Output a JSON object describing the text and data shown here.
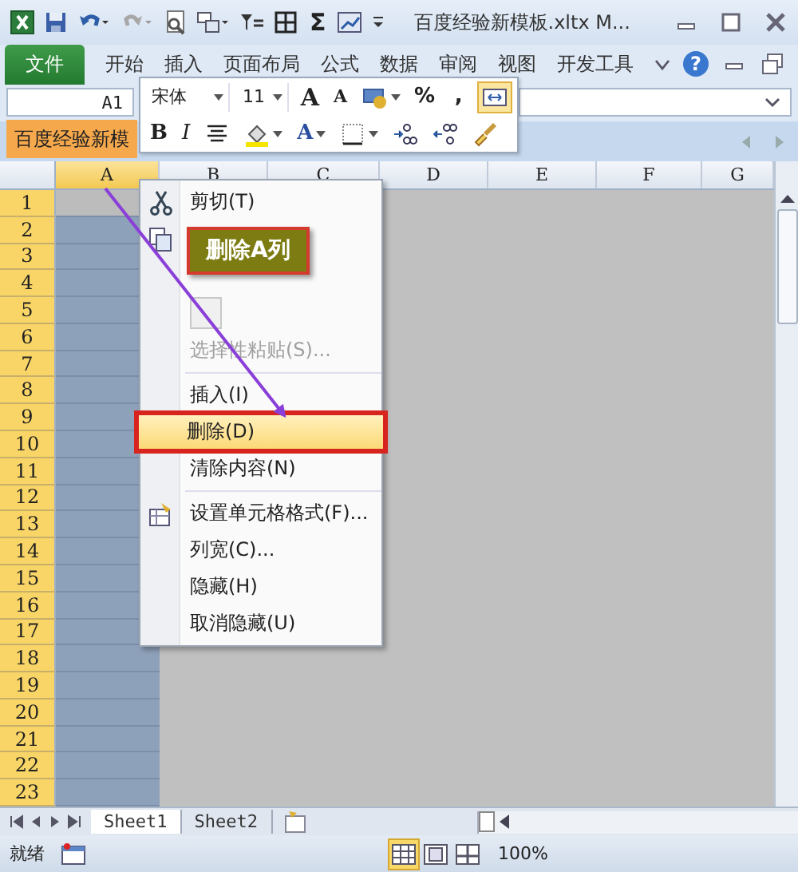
{
  "title_bar": {
    "title": "百度经验新模板.xltx M...",
    "quick_access": [
      {
        "kind": "logo"
      },
      {
        "kind": "save"
      },
      {
        "kind": "undo"
      },
      {
        "kind": "redo"
      },
      {
        "kind": "preview"
      },
      {
        "kind": "layout"
      },
      {
        "kind": "filter"
      },
      {
        "kind": "borders"
      },
      {
        "kind": "sum",
        "label": "Σ"
      },
      {
        "kind": "chart"
      },
      {
        "kind": "customize"
      }
    ]
  },
  "ribbon_tabs": [
    {
      "label": "文件",
      "kind": "file"
    },
    {
      "label": "开始",
      "kind": "tab"
    },
    {
      "label": "插入",
      "kind": "tab"
    },
    {
      "label": "页面布局",
      "kind": "tab"
    },
    {
      "label": "公式",
      "kind": "tab"
    },
    {
      "label": "数据",
      "kind": "tab"
    },
    {
      "label": "审阅",
      "kind": "tab"
    },
    {
      "label": "视图",
      "kind": "tab"
    },
    {
      "label": "开发工具",
      "kind": "tab"
    }
  ],
  "help": "?",
  "name_box": {
    "value": "A1"
  },
  "workbook_tab": {
    "label": "百度经验新模"
  },
  "mini_toolbar": {
    "font": "宋体",
    "size": "11",
    "row1": [
      {
        "kind": "grow",
        "label": "A",
        "on": false
      },
      {
        "kind": "shrink",
        "label": "A",
        "on": false
      },
      {
        "kind": "cell-format",
        "on": false
      },
      {
        "kind": "text",
        "label": "%",
        "on": false
      },
      {
        "kind": "text",
        "label": ",",
        "on": false
      },
      {
        "kind": "merge",
        "on": true
      }
    ],
    "row2": [
      {
        "kind": "bold",
        "label": "B"
      },
      {
        "kind": "italic",
        "label": "I"
      },
      {
        "kind": "align"
      },
      {
        "kind": "fill"
      },
      {
        "kind": "font-color",
        "label": "A"
      },
      {
        "kind": "borders"
      },
      {
        "kind": "increase-decimal"
      },
      {
        "kind": "decrease-decimal"
      },
      {
        "kind": "painter"
      }
    ]
  },
  "grid": {
    "rows_highlighted": true,
    "columns": [
      {
        "label": "A",
        "selected": true
      },
      {
        "label": "B",
        "selected": false
      },
      {
        "label": "C",
        "selected": false
      },
      {
        "label": "D",
        "selected": false
      },
      {
        "label": "E",
        "selected": false
      },
      {
        "label": "F",
        "selected": false
      },
      {
        "label": "G",
        "selected": false
      }
    ],
    "rows": [
      {
        "label": "1",
        "active": true
      },
      {
        "label": "2",
        "active": false
      },
      {
        "label": "3",
        "active": false
      },
      {
        "label": "4",
        "active": false
      },
      {
        "label": "5",
        "active": false
      },
      {
        "label": "6",
        "active": false
      },
      {
        "label": "7",
        "active": false
      },
      {
        "label": "8",
        "active": false
      },
      {
        "label": "9",
        "active": false
      },
      {
        "label": "10",
        "active": false
      },
      {
        "label": "11",
        "active": false
      },
      {
        "label": "12",
        "active": false
      },
      {
        "label": "13",
        "active": false
      },
      {
        "label": "14",
        "active": false
      },
      {
        "label": "15",
        "active": false
      },
      {
        "label": "16",
        "active": false
      },
      {
        "label": "17",
        "active": false
      },
      {
        "label": "18",
        "active": false
      },
      {
        "label": "19",
        "active": false
      },
      {
        "label": "20",
        "active": false
      },
      {
        "label": "21",
        "active": false
      },
      {
        "label": "22",
        "active": false
      },
      {
        "label": "23",
        "active": false
      }
    ]
  },
  "context_menu": [
    {
      "kind": "cut",
      "label": "剪切(T)",
      "disabled": false,
      "selected": false
    },
    {
      "kind": "copy"
    },
    {
      "kind": "blank"
    },
    {
      "kind": "paste"
    },
    {
      "kind": "item",
      "label": "选择性粘贴(S)...",
      "disabled": true,
      "selected": false
    },
    {
      "kind": "separator"
    },
    {
      "kind": "item",
      "label": "插入(I)",
      "disabled": false,
      "selected": false
    },
    {
      "kind": "item",
      "label": "删除(D)",
      "disabled": false,
      "selected": true
    },
    {
      "kind": "item",
      "label": "清除内容(N)",
      "disabled": false,
      "selected": false
    },
    {
      "kind": "separator"
    },
    {
      "kind": "format",
      "label": "设置单元格格式(F)...",
      "disabled": false,
      "selected": false
    },
    {
      "kind": "item",
      "label": "列宽(C)...",
      "disabled": false,
      "selected": false
    },
    {
      "kind": "item",
      "label": "隐藏(H)",
      "disabled": false,
      "selected": false
    },
    {
      "kind": "item",
      "label": "取消隐藏(U)",
      "disabled": false,
      "selected": false
    }
  ],
  "callout": {
    "text": "删除A列"
  },
  "sheet_tabs": [
    {
      "label": "Sheet1",
      "selected": true
    },
    {
      "label": "Sheet2",
      "selected": false
    }
  ],
  "status_bar": {
    "ready": "就绪",
    "zoom": "100%",
    "views": [
      {
        "kind": "normal",
        "selected": true
      },
      {
        "kind": "page-layout",
        "selected": false
      },
      {
        "kind": "page-break",
        "selected": false
      }
    ]
  }
}
